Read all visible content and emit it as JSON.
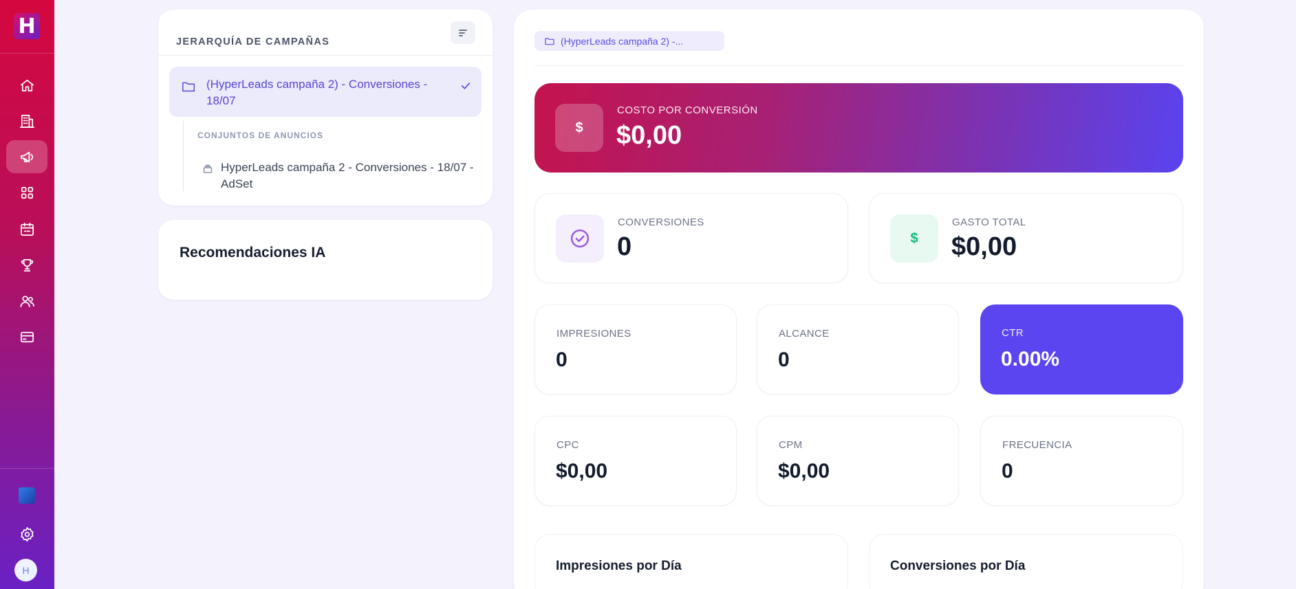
{
  "sidebar": {
    "logo_text": "H",
    "nav": [
      {
        "icon": "home-icon"
      },
      {
        "icon": "building-icon"
      },
      {
        "icon": "megaphone-icon",
        "active": true
      },
      {
        "icon": "grid-icon"
      },
      {
        "icon": "calendar-icon"
      },
      {
        "icon": "trophy-icon"
      },
      {
        "icon": "users-icon"
      },
      {
        "icon": "credit-card-icon"
      }
    ],
    "avatar_text": "H"
  },
  "hierarchy": {
    "title": "JERARQUÍA DE CAMPAÑAS",
    "campaign": "(HyperLeads campaña 2) - Conversiones - 18/07",
    "adsets_header": "CONJUNTOS DE ANUNCIOS",
    "adset": "HyperLeads campaña 2 - Conversiones - 18/07 - AdSet"
  },
  "recommendations": {
    "title": "Recomendaciones IA"
  },
  "main": {
    "breadcrumb": "(HyperLeads campaña 2) -...",
    "hero": {
      "label": "COSTO POR CONVERSIÓN",
      "value": "$0,00",
      "icon_text": "$"
    },
    "conversions": {
      "label": "CONVERSIONES",
      "value": "0"
    },
    "spend": {
      "label": "GASTO TOTAL",
      "value": "$0,00",
      "icon_text": "$"
    },
    "impressions": {
      "label": "IMPRESIONES",
      "value": "0"
    },
    "reach": {
      "label": "ALCANCE",
      "value": "0"
    },
    "ctr": {
      "label": "CTR",
      "value": "0.00%"
    },
    "cpc": {
      "label": "CPC",
      "value": "$0,00"
    },
    "cpm": {
      "label": "CPM",
      "value": "$0,00"
    },
    "frequency": {
      "label": "FRECUENCIA",
      "value": "0"
    },
    "chart_impressions_title": "Impresiones por Día",
    "chart_conversions_title": "Conversiones por Día"
  },
  "colors": {
    "accent": "#5b45f0",
    "sidebar_top": "#d5073f",
    "sidebar_bottom": "#6a20c4",
    "success": "#10b981"
  }
}
